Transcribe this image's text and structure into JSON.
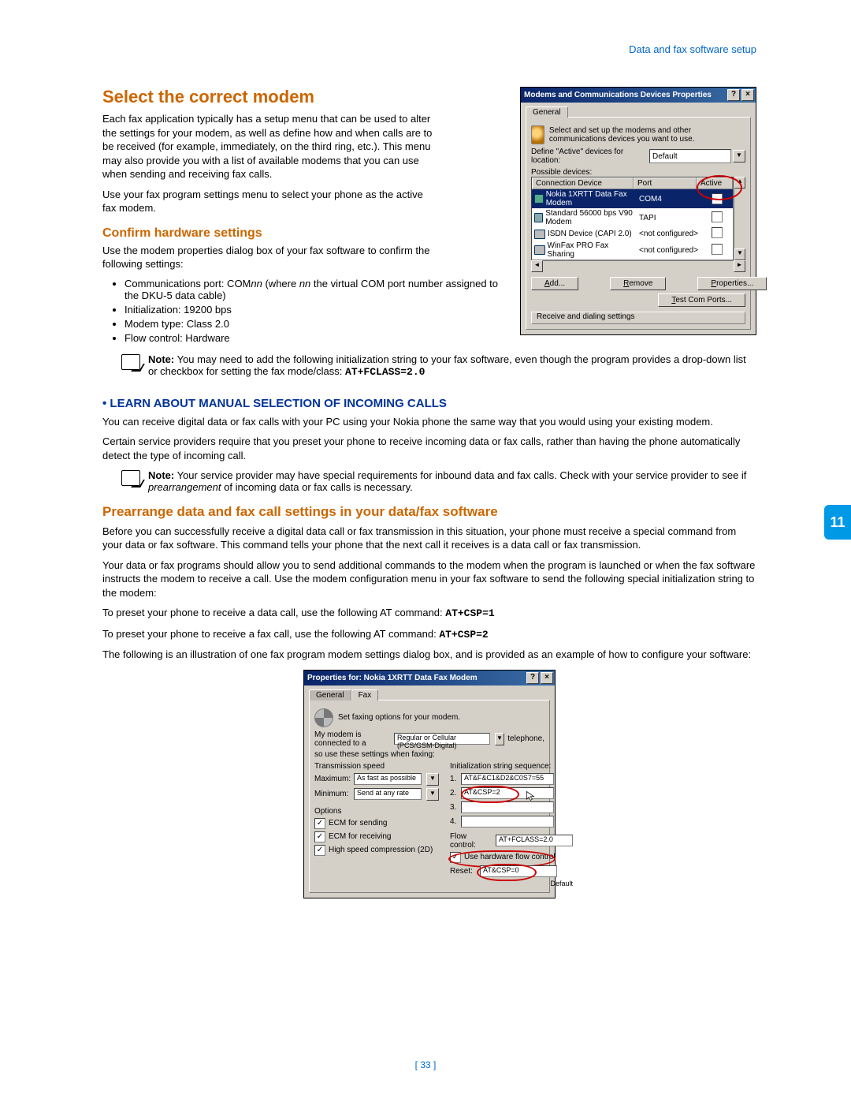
{
  "breadcrumb": "Data and fax software setup",
  "h1": "Select the correct modem",
  "p1": "Each fax application typically has a setup menu that can be used to alter the settings for your modem, as well as define how and when calls are to be received (for example, immediately, on the third ring, etc.). This menu may also provide you with a list of available modems that you can use when sending and receiving fax calls.",
  "p2": "Use your fax program settings menu to select your phone as the active fax modem.",
  "h2a": "Confirm hardware settings",
  "p3": "Use the modem properties dialog box of your fax software to confirm the following settings:",
  "bullets1": {
    "b1_pre": "Communications port: COM",
    "b1_nn": "nn",
    "b1_mid": " (where ",
    "b1_nn2": "nn",
    "b1_post": " the virtual COM port number assigned to the DKU-5 data cable)",
    "b2": "Initialization: 19200 bps",
    "b3": "Modem type: Class 2.0",
    "b4": "Flow control: Hardware"
  },
  "note1_label": "Note:",
  "note1": " You may need to add the following initialization string to your fax software, even though the program provides a drop-down list or checkbox for setting the fax mode/class: ",
  "note1_code": "AT+FCLASS=2.0",
  "blue_head": "LEARN ABOUT MANUAL SELECTION OF INCOMING CALLS",
  "p4": "You can receive digital data or fax calls with your PC using your Nokia phone the same way that you would using your existing modem.",
  "p5": "Certain service providers require that you preset your phone to receive incoming data or fax calls, rather than having the phone automatically detect the type of incoming call.",
  "note2_label": "Note:",
  "note2a": " Your service provider may have special requirements for inbound data and fax calls. Check with your service provider to see if ",
  "note2_em": "prearrangement",
  "note2b": " of incoming data or fax calls is necessary.",
  "h2b": "Prearrange data and fax call settings in your data/fax software",
  "p6": "Before you can successfully receive a digital data call or fax transmission in this situation, your phone must receive a special command from your data or fax software. This command tells your phone that the next call it receives is a data call or fax transmission.",
  "p7": "Your data or fax programs should allow you to send additional commands to the modem when the program is launched or when the fax software instructs the modem to receive a call. Use the modem configuration menu in your fax software to send the following special initialization string to the modem:",
  "p8_pre": "To preset your phone to receive a data call, use the following AT command: ",
  "p8_code": "AT+CSP=1",
  "p9_pre": "To preset your phone to receive a fax call, use the following AT command: ",
  "p9_code": "AT+CSP=2",
  "p10": "The following is an illustration of one fax program modem settings dialog box, and is provided as an example of how to configure your software:",
  "page_num": "[ 33 ]",
  "side_tab": "11",
  "dlg1": {
    "title": "Modems and Communications Devices Properties",
    "tab": "General",
    "intro": "Select and set up the modems and other communications devices you want to use.",
    "define_label": "Define \"Active\" devices for location:",
    "define_value": "Default",
    "possible": "Possible devices:",
    "headers": {
      "conn": "Connection Device",
      "port": "Port",
      "active": "Active"
    },
    "rows": [
      {
        "name": "Nokia 1XRTT Data Fax Modem",
        "port": "COM4",
        "checked": true,
        "sel": true
      },
      {
        "name": "Standard 56000 bps V90 Modem",
        "port": "TAPI",
        "checked": false,
        "sel": false
      },
      {
        "name": "ISDN Device (CAPI 2.0)",
        "port": "<not configured>",
        "checked": false,
        "sel": false
      },
      {
        "name": "WinFax PRO Fax Sharing",
        "port": "<not configured>",
        "checked": false,
        "sel": false
      }
    ],
    "btn_add": "Add...",
    "btn_remove": "Remove",
    "btn_props": "Properties...",
    "btn_test": "Test Com Ports...",
    "group": "Receive and dialing settings"
  },
  "dlg2": {
    "title": "Properties for: Nokia 1XRTT Data Fax Modem",
    "tab_general": "General",
    "tab_fax": "Fax",
    "intro": "Set faxing options for your modem.",
    "line1a": "My modem is connected to a",
    "line1_select": "Regular or Cellular (PCS/GSM-Digital)",
    "line1b": "telephone,",
    "line2": "so use these settings when faxing:",
    "ts_head": "Transmission speed",
    "init_head": "Initialization string sequence:",
    "max_label": "Maximum:",
    "max_val": "As fast as possible",
    "min_label": "Minimum:",
    "min_val": "Send at any rate",
    "init1": "AT&F&C1&D2&C0S7=55",
    "init2": "AT&CSP=2",
    "options_head": "Options",
    "opt1": "ECM for sending",
    "opt2": "ECM for receiving",
    "opt3": "High speed compression (2D)",
    "flow_label": "Flow control:",
    "flow_val": "AT+FCLASS=2.0",
    "hw_flow": "Use hardware flow control",
    "reset_label": "Reset:",
    "reset_val": "AT&CSP=0",
    "default": "Default"
  }
}
